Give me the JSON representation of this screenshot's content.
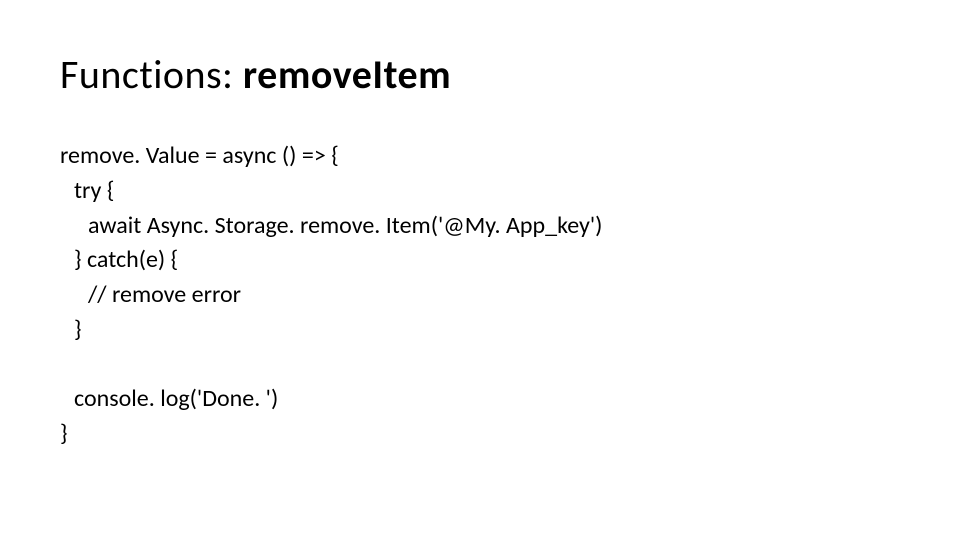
{
  "title": {
    "prefix": "Functions: ",
    "name": "removeItem"
  },
  "code": {
    "line1": "remove. Value = async () => {",
    "line2": "try {",
    "line3": "await Async. Storage. remove. Item('@My. App_key')",
    "line4": "} catch(e) {",
    "line5": "// remove error",
    "line6": "}",
    "line7": "console. log('Done. ')",
    "line8": "}"
  }
}
